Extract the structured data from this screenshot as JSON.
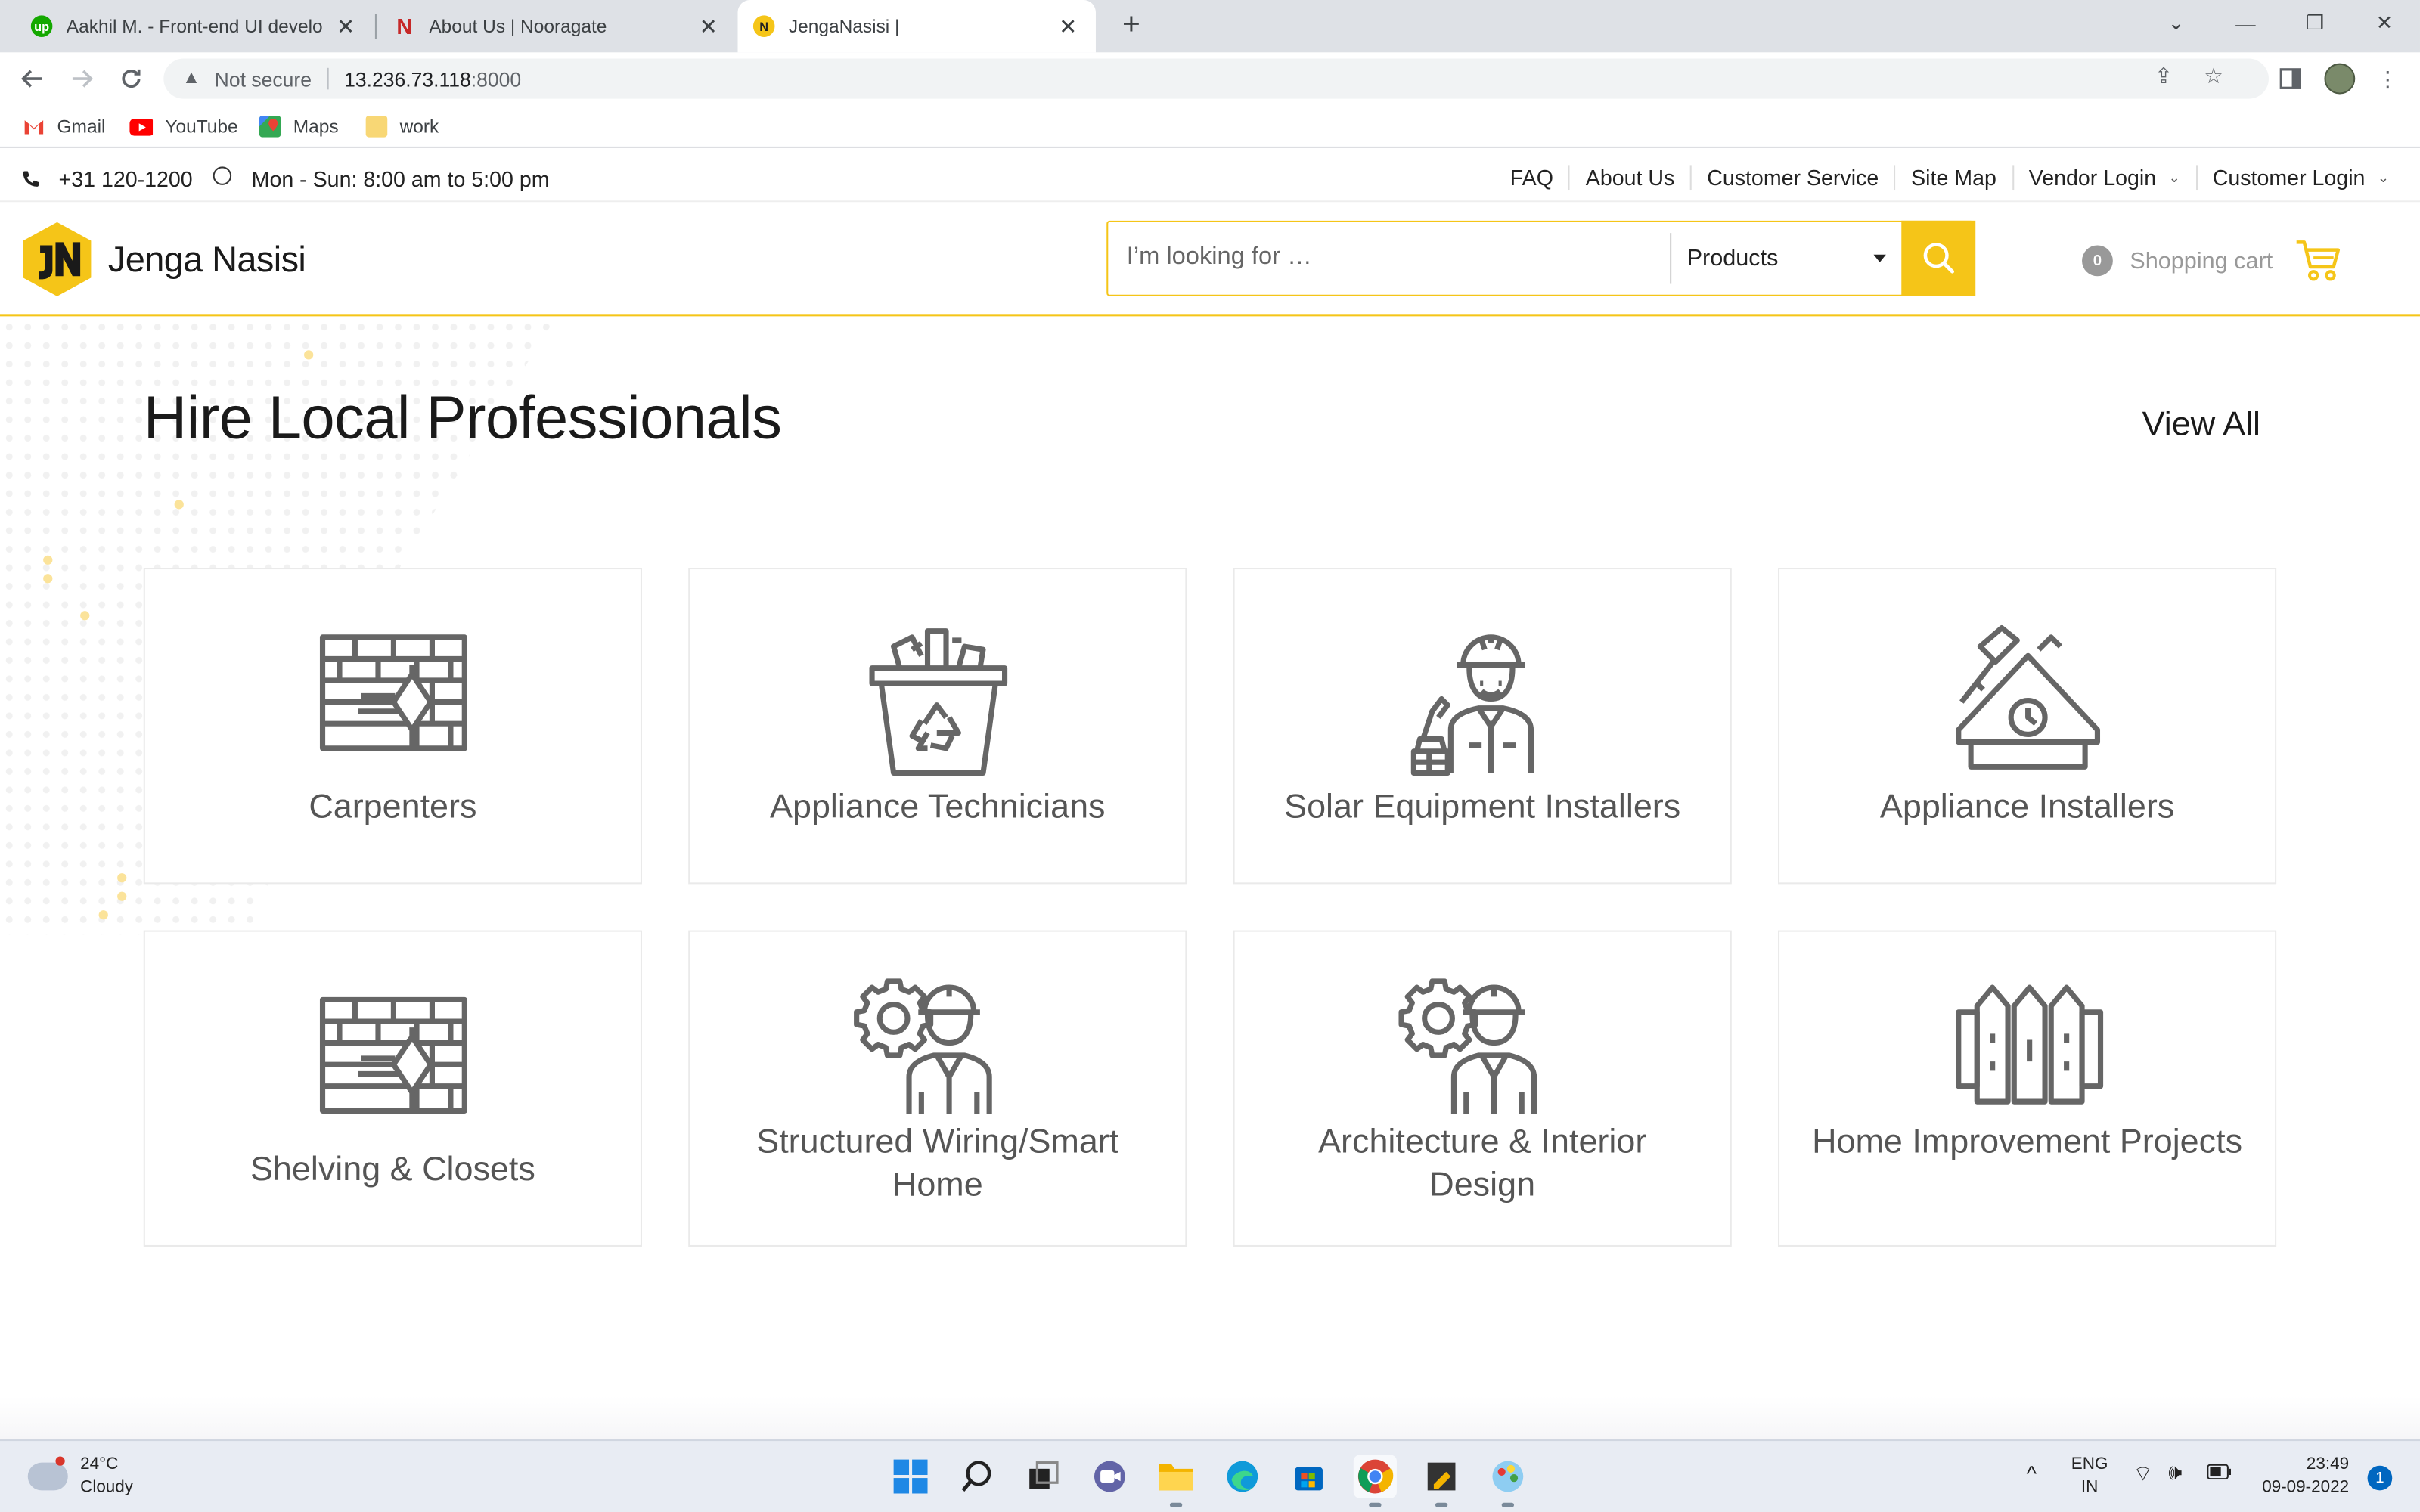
{
  "browser": {
    "tabs": [
      {
        "title": "Aakhil M. - Front-end UI develop",
        "favicon": "upwork-icon",
        "color": "#14a800"
      },
      {
        "title": "About Us | Nooragate",
        "favicon": "nooragate-icon",
        "color": "#c62828"
      },
      {
        "title": "JengaNasisi |",
        "favicon": "jenga-nasisi-icon",
        "color": "#f5c518",
        "active": true
      }
    ],
    "security_label": "Not secure",
    "url": "13.236.73.118",
    "url_port": ":8000",
    "bookmarks": [
      "Gmail",
      "YouTube",
      "Maps",
      "work"
    ]
  },
  "site": {
    "topbar": {
      "phone": "+31 120-1200",
      "hours": "Mon - Sun: 8:00 am to 5:00 pm",
      "links": [
        "FAQ",
        "About Us",
        "Customer Service",
        "Site Map",
        "Vendor Login",
        "Customer Login"
      ]
    },
    "header": {
      "logo_text": "Jenga Nasisi",
      "search_placeholder": "I’m looking for …",
      "search_category": "Products",
      "cart_count": "0",
      "cart_label": "Shopping cart"
    },
    "section": {
      "title": "Hire Local Professionals",
      "view_all": "View All",
      "categories": [
        {
          "label": "Carpenters",
          "icon": "brick-wall-trowel-icon"
        },
        {
          "label": "Appliance Technicians",
          "icon": "recycle-bin-icon"
        },
        {
          "label": "Solar Equipment Installers",
          "icon": "construction-worker-icon"
        },
        {
          "label": "Appliance Installers",
          "icon": "house-hammer-icon"
        },
        {
          "label": "Shelving & Closets",
          "icon": "brick-wall-trowel-icon"
        },
        {
          "label": "Structured Wiring/Smart Home",
          "icon": "engineer-gear-icon"
        },
        {
          "label": "Architecture & Interior Design",
          "icon": "engineer-gear-icon"
        },
        {
          "label": "Home Improvement Projects",
          "icon": "fence-icon"
        }
      ]
    }
  },
  "taskbar": {
    "temperature": "24°C",
    "condition": "Cloudy",
    "language": "ENG",
    "region": "IN",
    "time": "23:49",
    "date": "09-09-2022",
    "notifications": "1"
  },
  "colors": {
    "accent": "#f5c518",
    "icon_gray": "#666666"
  }
}
